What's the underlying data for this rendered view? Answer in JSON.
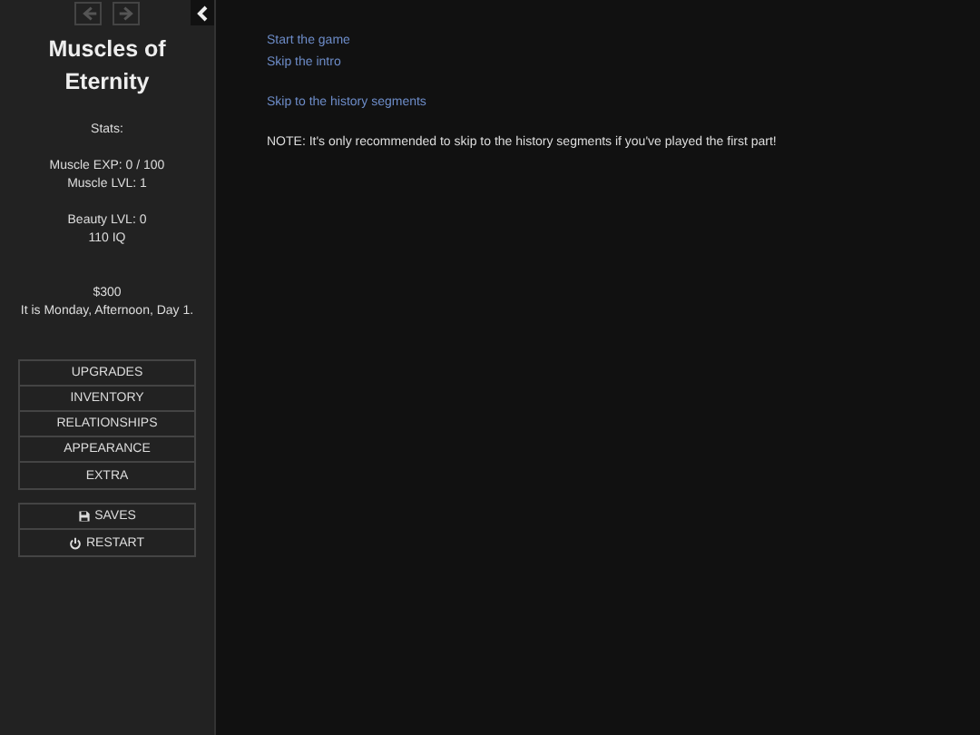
{
  "sidebar": {
    "history": [
      {
        "kind": "back",
        "disabled": true
      },
      {
        "kind": "forward",
        "disabled": true
      }
    ],
    "title": "Muscles of Eternity",
    "stat_groups": [
      [
        "Stats:"
      ],
      [
        "Muscle EXP: 0 / 100",
        "Muscle LVL: 1"
      ],
      [
        "Beauty LVL: 0",
        "110 IQ"
      ],
      [
        "$300",
        "It is Monday, Afternoon, Day 1."
      ]
    ],
    "menu": [
      "UPGRADES",
      "INVENTORY",
      "RELATIONSHIPS",
      "APPEARANCE",
      "EXTRA"
    ],
    "menu_2": [
      {
        "kind": "save",
        "label": "SAVES"
      },
      {
        "kind": "power",
        "label": "RESTART"
      }
    ]
  },
  "main": {
    "link_groups": [
      [
        "Start the game",
        "Skip the intro"
      ],
      [
        "Skip to the history segments"
      ]
    ],
    "note": "NOTE: It's only recommended to skip to the history segments if you've played the first part!"
  }
}
